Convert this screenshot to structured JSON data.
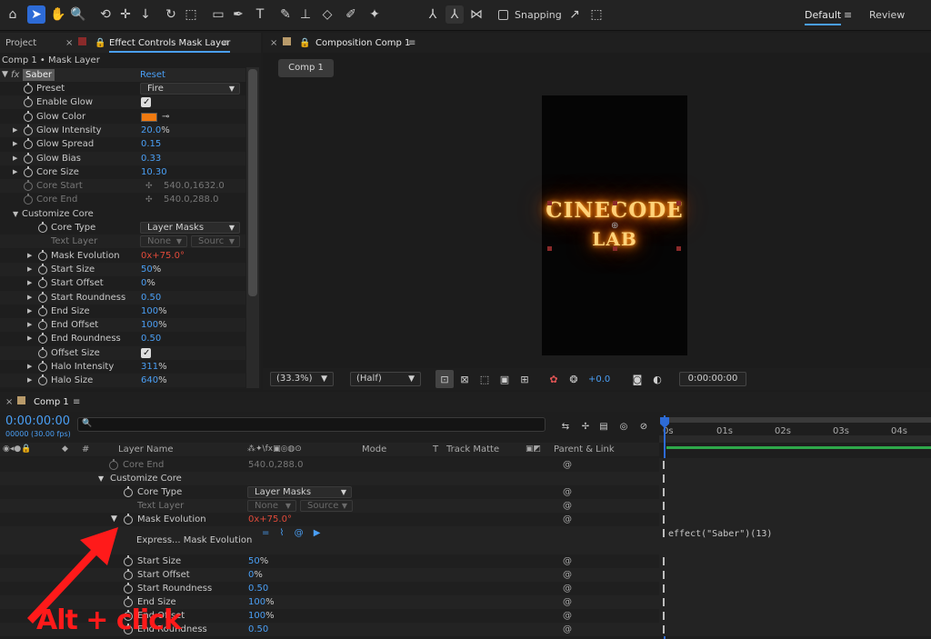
{
  "toolbar": {
    "snapping_label": "Snapping",
    "workspace_default": "Default",
    "workspace_review": "Review"
  },
  "left_panel": {
    "tab_project": "Project",
    "tab_effect_controls": "Effect Controls Mask Layer",
    "breadcrumb": "Comp 1 • Mask Layer",
    "effect_name": "Saber",
    "reset_label": "Reset",
    "properties": [
      {
        "label": "Preset",
        "value": "Fire",
        "kind": "dropdown"
      },
      {
        "label": "Enable Glow",
        "kind": "checkbox",
        "checked": true
      },
      {
        "label": "Glow Color",
        "kind": "color",
        "color": "#f07a10"
      },
      {
        "label": "Glow Intensity",
        "value": "20.0",
        "unit": "%",
        "kind": "value",
        "twisty": true
      },
      {
        "label": "Glow Spread",
        "value": "0.15",
        "kind": "value",
        "twisty": true
      },
      {
        "label": "Glow Bias",
        "value": "0.33",
        "kind": "value",
        "twisty": true
      },
      {
        "label": "Core Size",
        "value": "10.30",
        "kind": "value",
        "twisty": true
      },
      {
        "label": "Core Start",
        "value": "540.0,1632.0",
        "kind": "point",
        "dim": true
      },
      {
        "label": "Core End",
        "value": "540.0,288.0",
        "kind": "point",
        "dim": true
      }
    ],
    "group_label": "Customize Core",
    "core_props": [
      {
        "label": "Core Type",
        "value": "Layer Masks",
        "kind": "dropdown"
      },
      {
        "label": "Text Layer",
        "value": "None",
        "value2": "Sourc",
        "kind": "dropdown2",
        "dim": true
      },
      {
        "label": "Mask Evolution",
        "value": "0",
        "value_suffix": "x+75.0°",
        "kind": "rotation",
        "twisty": true
      },
      {
        "label": "Start Size",
        "value": "50",
        "unit": "%",
        "kind": "value",
        "twisty": true
      },
      {
        "label": "Start Offset",
        "value": "0",
        "unit": "%",
        "kind": "value",
        "twisty": true
      },
      {
        "label": "Start Roundness",
        "value": "0.50",
        "kind": "value",
        "twisty": true
      },
      {
        "label": "End Size",
        "value": "100",
        "unit": "%",
        "kind": "value",
        "twisty": true
      },
      {
        "label": "End Offset",
        "value": "100",
        "unit": "%",
        "kind": "value",
        "twisty": true
      },
      {
        "label": "End Roundness",
        "value": "0.50",
        "kind": "value",
        "twisty": true
      },
      {
        "label": "Offset Size",
        "kind": "checkbox",
        "checked": true
      },
      {
        "label": "Halo Intensity",
        "value": "311",
        "unit": "%",
        "kind": "value",
        "twisty": true
      },
      {
        "label": "Halo Size",
        "value": "640",
        "unit": "%",
        "kind": "value",
        "twisty": true
      }
    ]
  },
  "viewer": {
    "tab_label": "Composition Comp 1",
    "comp_button": "Comp 1",
    "line1": "CINECODE",
    "line2": "LAB",
    "zoom": "(33.3%)",
    "resolution": "(Half)",
    "exposure": "+0.0",
    "timecode": "0:00:00:00"
  },
  "timeline": {
    "tab_label": "Comp 1",
    "current_time": "0:00:00:00",
    "frame_info": "00000 (30.00 fps)",
    "col_layer_name": "Layer Name",
    "col_mode": "Mode",
    "col_t": "T",
    "col_track_matte": "Track Matte",
    "col_parent": "Parent & Link",
    "ruler": [
      "0s",
      "01s",
      "02s",
      "03s",
      "04s"
    ],
    "rows": {
      "core_end_label": "Core End",
      "core_end_value": "540.0,288.0",
      "customize_core": "Customize Core",
      "core_type_label": "Core Type",
      "core_type_value": "Layer Masks",
      "text_layer_label": "Text Layer",
      "text_layer_v1": "None",
      "text_layer_v2": "Source",
      "mask_evo_label": "Mask Evolution",
      "mask_evo_v1": "0",
      "mask_evo_v2": "x+75.0°",
      "expr_label": "Express... Mask Evolution",
      "expression": "effect(\"Saber\")(13)",
      "start_size_label": "Start Size",
      "start_size": "50",
      "start_size_unit": "%",
      "start_offset_label": "Start Offset",
      "start_offset": "0",
      "start_offset_unit": "%",
      "start_round_label": "Start Roundness",
      "start_round": "0.50",
      "end_size_label": "End Size",
      "end_size": "100",
      "end_size_unit": "%",
      "end_offset_label": "End Offset",
      "end_offset": "100",
      "end_offset_unit": "%",
      "end_round_label": "End Roundness",
      "end_round": "0.50"
    }
  },
  "annotation": {
    "text": "Alt + click",
    "color": "#ff1a1a"
  }
}
